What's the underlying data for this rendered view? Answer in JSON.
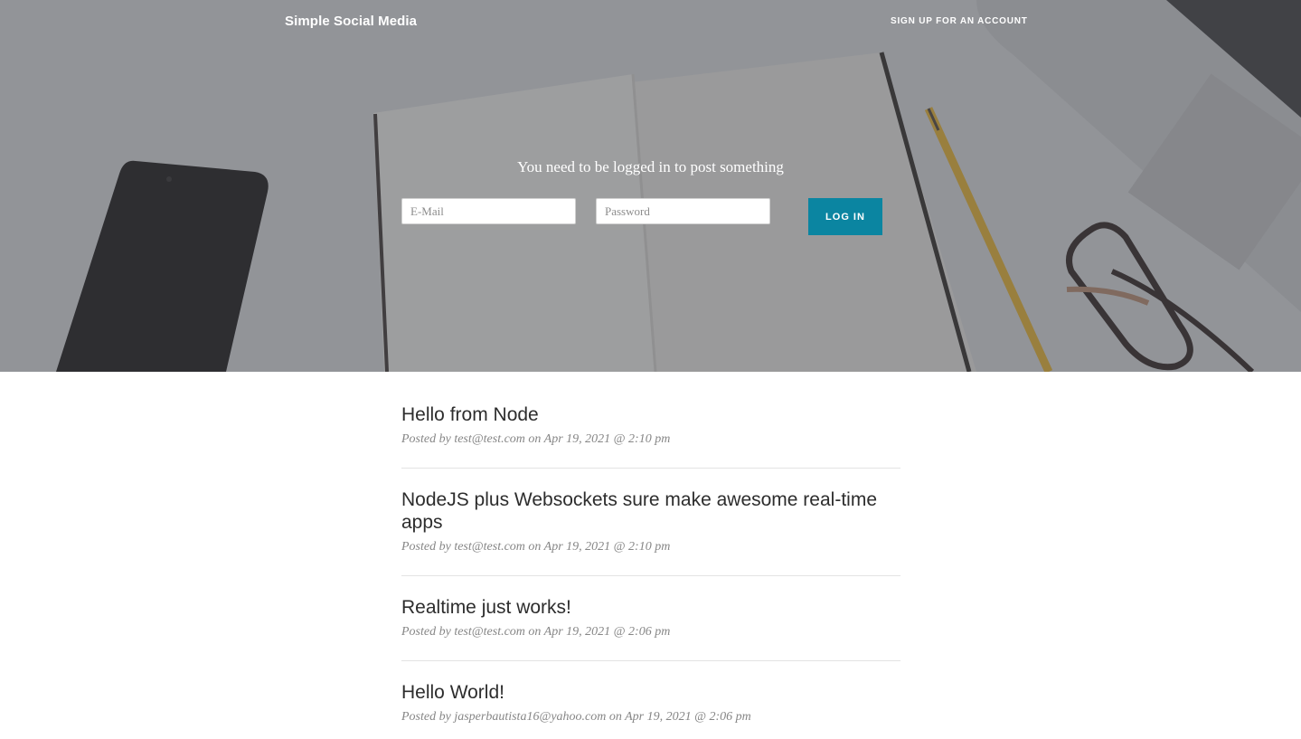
{
  "header": {
    "brand": "Simple Social Media",
    "signup_link": "SIGN UP FOR AN ACCOUNT"
  },
  "hero": {
    "message": "You need to be logged in to post something",
    "email_placeholder": "E-Mail",
    "password_placeholder": "Password",
    "login_button": "LOG IN"
  },
  "posts": [
    {
      "title": "Hello from Node",
      "prefix": "Posted by",
      "author": "test@test.com",
      "on": "on",
      "date": "Apr 19, 2021 @ 2:10 pm"
    },
    {
      "title": "NodeJS plus Websockets sure make awesome real-time apps",
      "prefix": "Posted by",
      "author": "test@test.com",
      "on": "on",
      "date": "Apr 19, 2021 @ 2:10 pm"
    },
    {
      "title": "Realtime just works!",
      "prefix": "Posted by",
      "author": "test@test.com",
      "on": "on",
      "date": "Apr 19, 2021 @ 2:06 pm"
    },
    {
      "title": "Hello World!",
      "prefix": "Posted by",
      "author": "jasperbautista16@yahoo.com",
      "on": "on",
      "date": "Apr 19, 2021 @ 2:06 pm"
    }
  ],
  "colors": {
    "accent": "#0b85a1",
    "overlay": "#484a50",
    "title": "#2d2d2d",
    "meta": "#868686"
  }
}
